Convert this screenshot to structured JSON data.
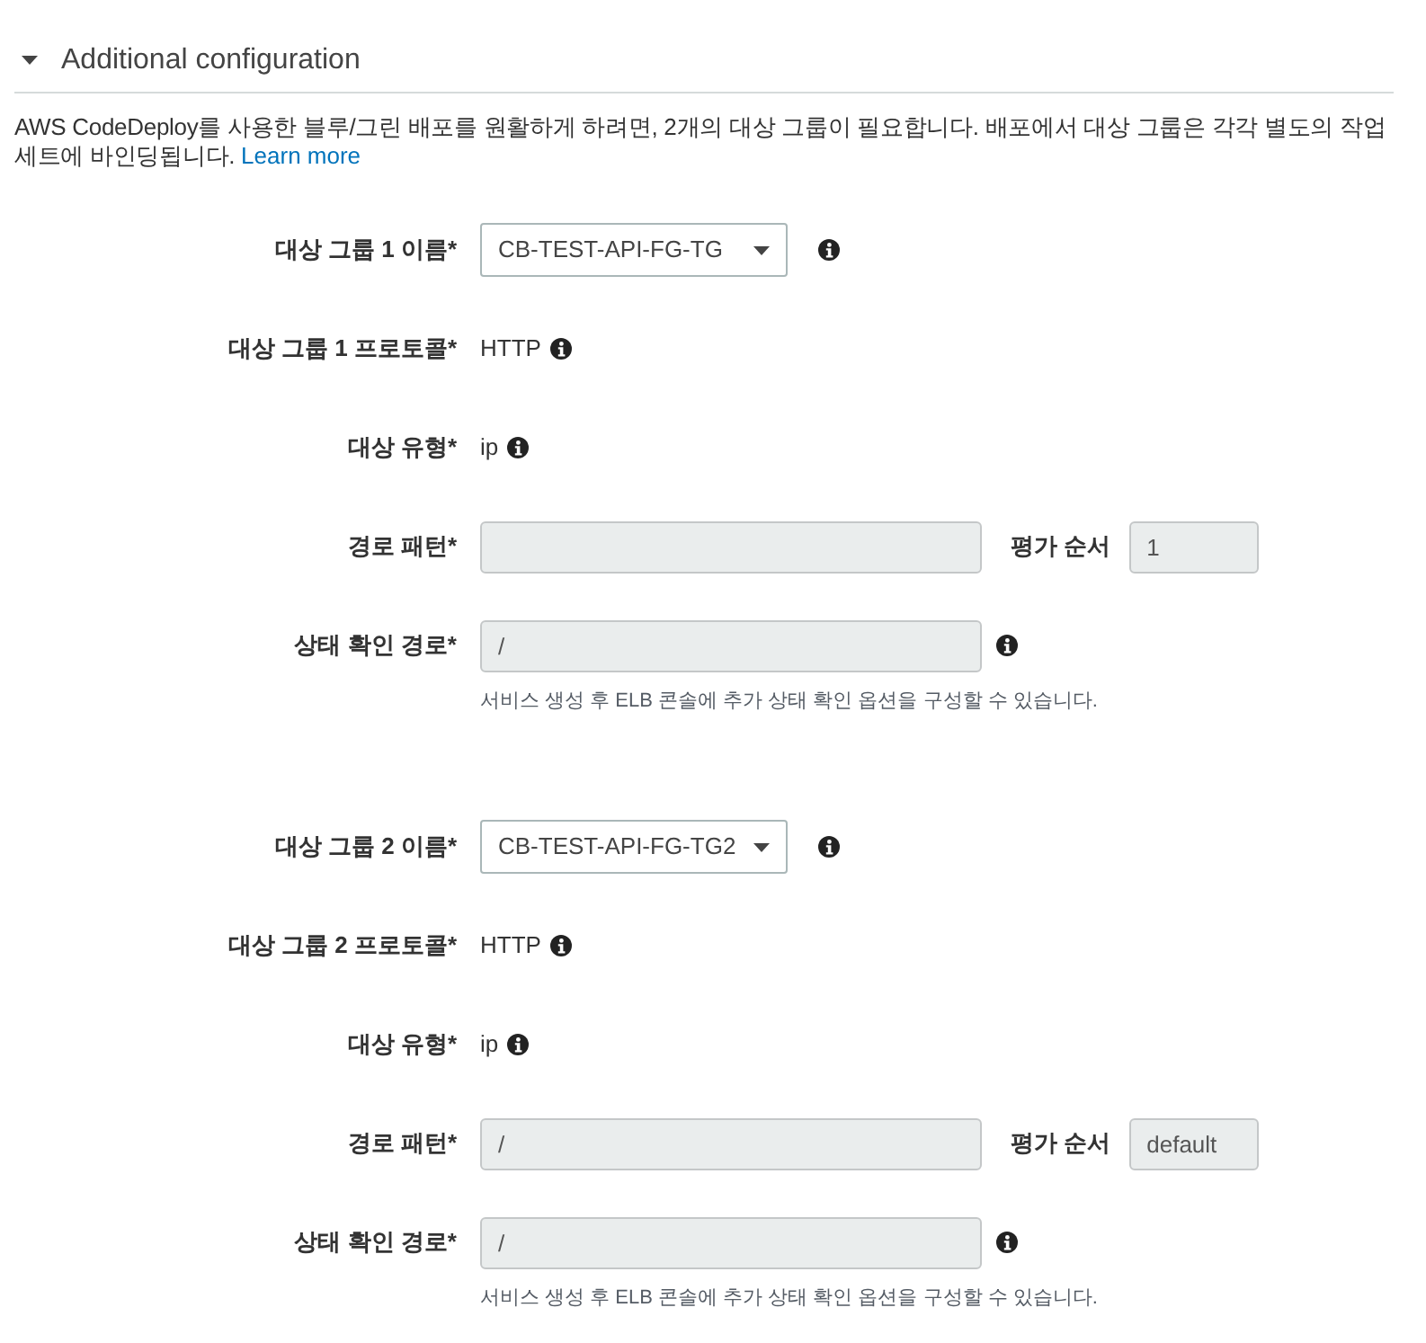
{
  "section": {
    "title": "Additional configuration",
    "expanded": true
  },
  "description": {
    "text": "AWS CodeDeploy를 사용한 블루/그린 배포를 원활하게 하려면, 2개의 대상 그룹이 필요합니다. 배포에서 대상 그룹은 각각 별도의 작업 세트에 바인딩됩니다.",
    "link": "Learn more"
  },
  "groups": [
    {
      "fields": [
        {
          "kind": "select",
          "label": "대상 그룹 1 이름*",
          "value": "CB-TEST-API-FG-TG",
          "info": true
        },
        {
          "kind": "text",
          "label": "대상 그룹 1 프로토콜*",
          "value": "HTTP",
          "info": true
        },
        {
          "kind": "text",
          "label": "대상 유형*",
          "value": "ip",
          "info": true
        },
        {
          "kind": "input",
          "label": "경로 패턴*",
          "disabled": true,
          "order": {
            "label": "평가 순서",
            "value": "1",
            "disabled": true
          }
        },
        {
          "kind": "input",
          "label": "상태 확인 경로*",
          "value": "/",
          "disabled": true,
          "info": true,
          "help": "서비스 생성 후 ELB 콘솔에 추가 상태 확인 옵션을 구성할 수 있습니다."
        }
      ]
    },
    {
      "fields": [
        {
          "kind": "select",
          "label": "대상 그룹 2 이름*",
          "value": "CB-TEST-API-FG-TG2",
          "info": true
        },
        {
          "kind": "text",
          "label": "대상 그룹 2 프로토콜*",
          "value": "HTTP",
          "info": true
        },
        {
          "kind": "text",
          "label": "대상 유형*",
          "value": "ip",
          "info": true
        },
        {
          "kind": "input",
          "label": "경로 패턴*",
          "value": "/",
          "disabled": true,
          "order": {
            "label": "평가 순서",
            "value": "default",
            "disabled": true
          }
        },
        {
          "kind": "input",
          "label": "상태 확인 경로*",
          "value": "/",
          "disabled": true,
          "info": true,
          "help": "서비스 생성 후 ELB 콘솔에 추가 상태 확인 옵션을 구성할 수 있습니다."
        }
      ]
    }
  ]
}
